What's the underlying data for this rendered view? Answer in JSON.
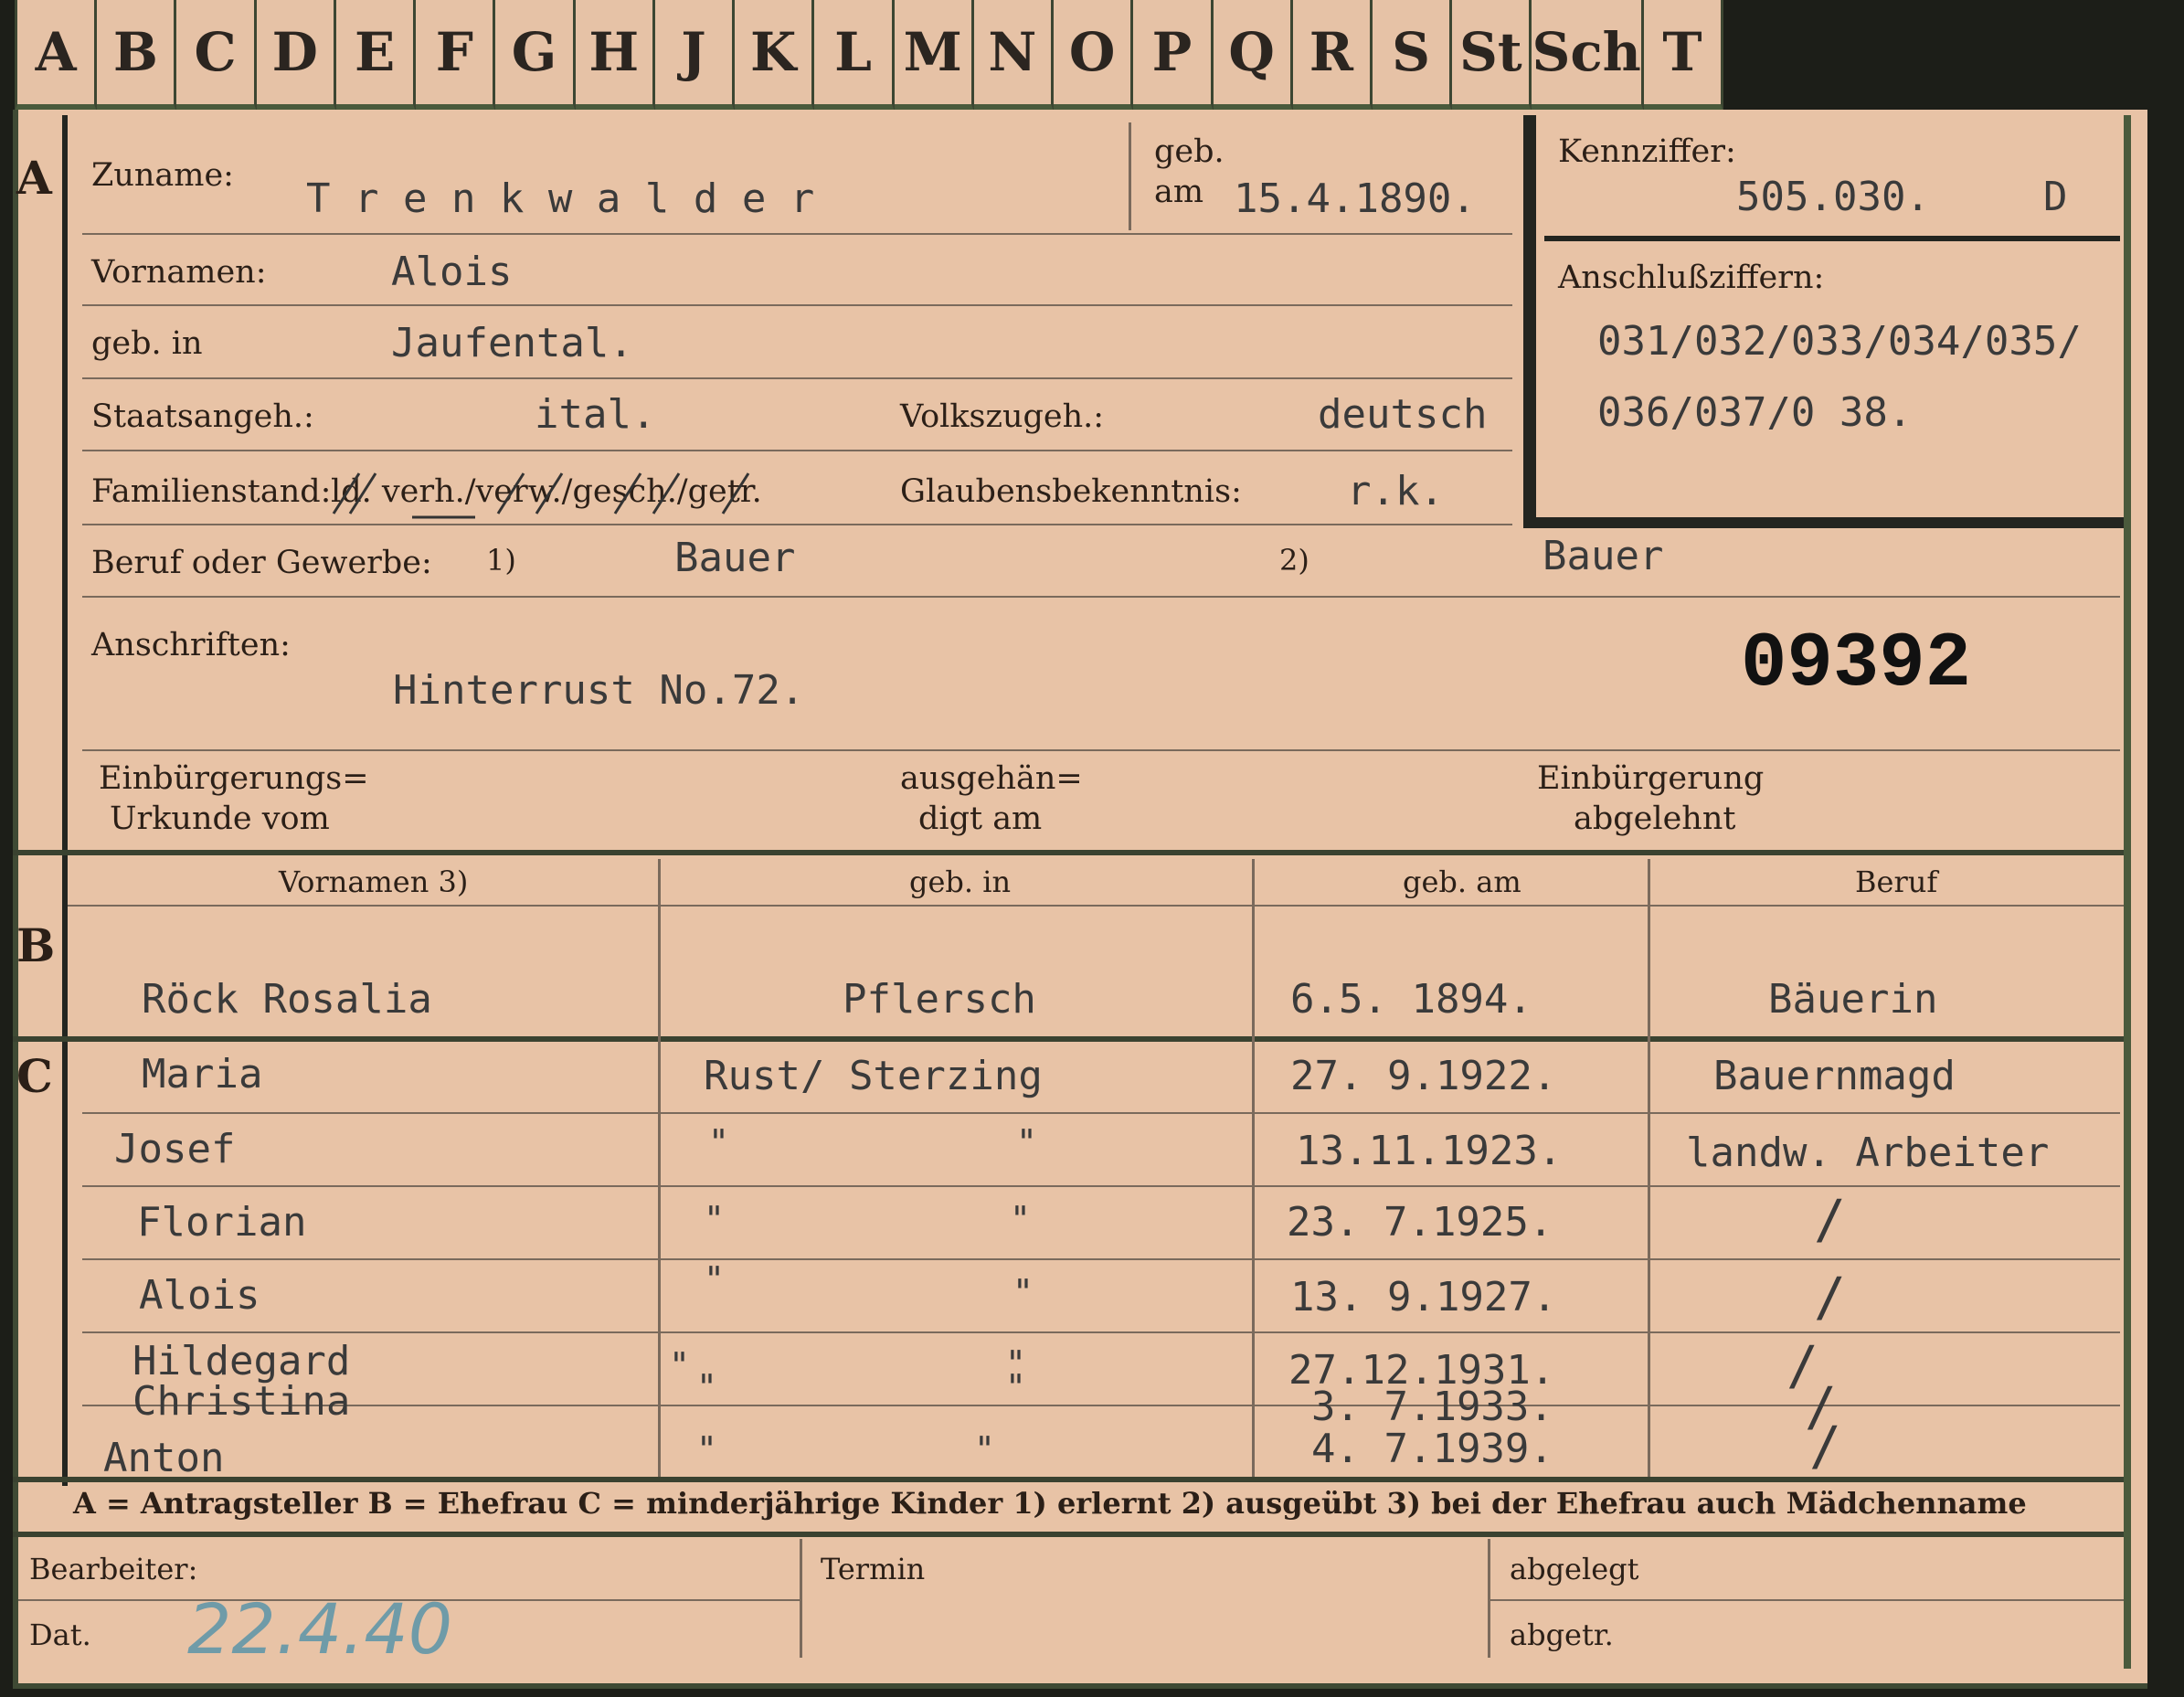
{
  "tabs": [
    "A",
    "B",
    "C",
    "D",
    "E",
    "F",
    "G",
    "H",
    "J",
    "K",
    "L",
    "M",
    "N",
    "O",
    "P",
    "Q",
    "R",
    "S",
    "St",
    "Sch",
    "T"
  ],
  "section_a": {
    "marker": "A",
    "zuname_label": "Zuname:",
    "zuname": "T r e n k w a l d e r",
    "geb_label": "geb.",
    "am_label": "am",
    "geb_am": "15.4.1890.",
    "vornamen_label": "Vornamen:",
    "vornamen": "Alois",
    "geb_in_label": "geb. in",
    "geb_in": "Jaufental.",
    "staatsangeh_label": "Staatsangeh.:",
    "staatsangeh": "ital.",
    "volkszugeh_label": "Volkszugeh.:",
    "volkszugeh": "deutsch",
    "familienstand_label": "Familienstand:",
    "familienstand_opts": "ld. verh./verw./gesch./getr.",
    "glauben_label": "Glaubensbekenntnis:",
    "glauben": "r.k.",
    "beruf_label": "Beruf oder Gewerbe:",
    "beruf_1_mark": "1)",
    "beruf_1": "Bauer",
    "beruf_2_mark": "2)",
    "beruf_2": "Bauer",
    "anschriften_label": "Anschriften:",
    "anschrift": "Hinterrust No.72.",
    "number": "09392",
    "einb_urkunde_label_1": "Einbürgerungs=",
    "einb_urkunde_label_2": "Urkunde vom",
    "ausgehaendigt_label_1": "ausgehän=",
    "ausgehaendigt_label_2": "digt am",
    "einb_abgelehnt_label_1": "Einbürgerung",
    "einb_abgelehnt_label_2": "abgelehnt"
  },
  "kennziffer": {
    "label": "Kennziffer:",
    "value": "505.030.",
    "suffix": "D",
    "anschluss_label": "Anschlußziffern:",
    "line1": "031/032/033/034/035/",
    "line2": "036/037/0 38."
  },
  "section_b": {
    "marker": "B",
    "headers": [
      "Vornamen 3)",
      "geb. in",
      "geb. am",
      "Beruf"
    ],
    "row": {
      "name": "Röck  Rosalia",
      "geb_in": "Pflersch",
      "geb_am": "6.5. 1894.",
      "beruf": "Bäuerin"
    }
  },
  "section_c": {
    "marker": "C",
    "geb_in_first": "Rust/ Sterzing",
    "ditto": "\"",
    "slash": "/",
    "rows": [
      {
        "name": "Maria",
        "geb_am": "27. 9.1922.",
        "beruf": "Bauernmagd"
      },
      {
        "name": "Josef",
        "geb_am": "13.11.1923.",
        "beruf": "landw. Arbeiter"
      },
      {
        "name": "Florian",
        "geb_am": "23. 7.1925.",
        "beruf": "/"
      },
      {
        "name": "Alois",
        "geb_am": "13. 9.1927.",
        "beruf": "/"
      },
      {
        "name": "Hildegard",
        "geb_am": "27.12.1931.",
        "beruf": "/"
      },
      {
        "name": "Christina",
        "geb_am": "3. 7.1933.",
        "beruf": "/"
      },
      {
        "name": "Anton",
        "geb_am": "4. 7.1939.",
        "beruf": "/"
      }
    ]
  },
  "legend": "A = Antragsteller   B = Ehefrau   C = minderjährige Kinder   1) erlernt   2) ausgeübt   3) bei der Ehefrau auch Mädchenname",
  "footer": {
    "bearbeiter_label": "Bearbeiter:",
    "dat_label": "Dat.",
    "dat_value": "22.4.40",
    "termin_label": "Termin",
    "abgelegt_label": "abgelegt",
    "abgetr_label": "abgetr."
  }
}
